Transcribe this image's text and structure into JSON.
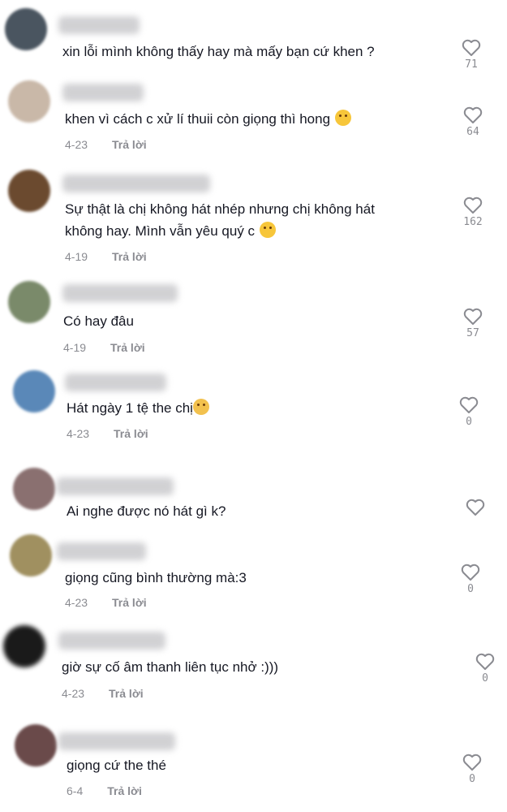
{
  "reply_label": "Trả lời",
  "comments": [
    {
      "text": "xin lỗi mình không thấy hay mà mấy bạn cứ khen ?",
      "date": "",
      "likes": "71",
      "avatar_color": "#4a5560"
    },
    {
      "text": "khen vì cách c xử lí thuii còn giọng thì hong",
      "date": "4-23",
      "likes": "64",
      "avatar_color": "#c9b8a8",
      "emoji": "laughing-emoji"
    },
    {
      "text": "Sự thật là chị không hát nhép nhưng chị không hát",
      "text2": "không hay. Mình vẫn yêu quý c",
      "date": "4-19",
      "likes": "162",
      "avatar_color": "#6b4a2f",
      "emoji": "smiling-hearts-emoji"
    },
    {
      "text": "Có hay đâu",
      "date": "4-19",
      "likes": "57",
      "avatar_color": "#7a8a6a"
    },
    {
      "text": "Hát ngày 1 tệ the chị",
      "date": "4-23",
      "likes": "0",
      "avatar_color": "#5a88b8",
      "emoji": "sad-face-emoji"
    },
    {
      "text": "Ai nghe được nó hát gì k?",
      "date": "",
      "likes": "",
      "avatar_color": "#8a7070"
    },
    {
      "text": "giọng cũng bình thường mà:3",
      "date": "4-23",
      "likes": "0",
      "avatar_color": "#a09060"
    },
    {
      "text": "giờ sự cố âm thanh liên tục nhở :)))",
      "date": "4-23",
      "likes": "0",
      "avatar_color": "#1a1a1a"
    },
    {
      "text": "giọng cứ the thé",
      "date": "6-4",
      "likes": "0",
      "avatar_color": "#6a4a4a"
    }
  ]
}
